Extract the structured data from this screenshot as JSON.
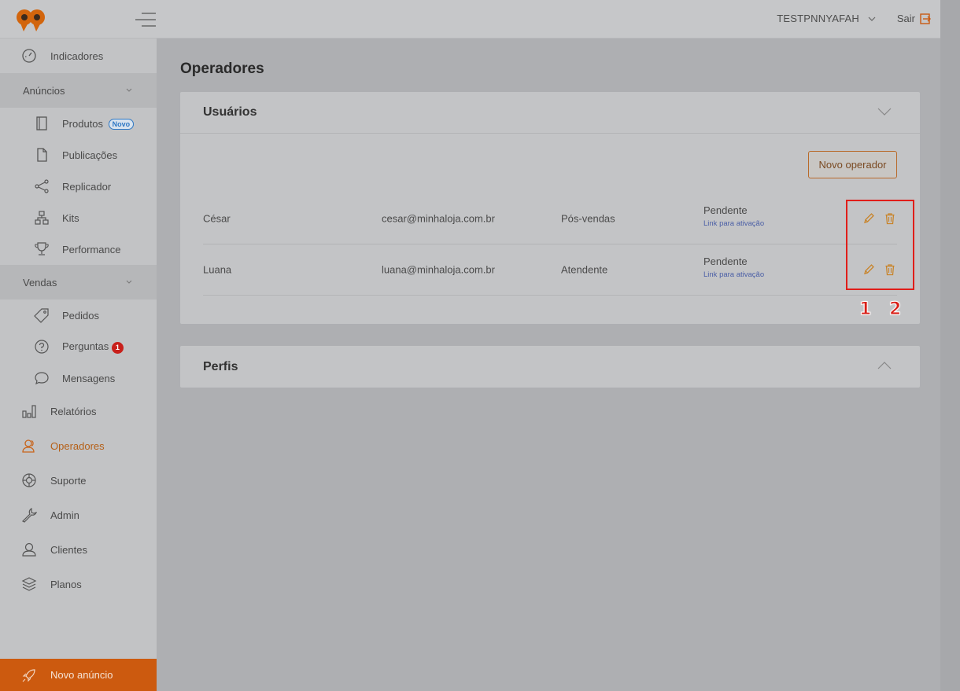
{
  "header": {
    "user_name": "TESTPNNYAFAH",
    "logout_label": "Sair"
  },
  "sidebar": {
    "indicadores": "Indicadores",
    "anuncios": "Anúncios",
    "produtos": "Produtos",
    "produtos_badge": "Novo",
    "publicacoes": "Publicações",
    "replicador": "Replicador",
    "kits": "Kits",
    "performance": "Performance",
    "vendas": "Vendas",
    "pedidos": "Pedidos",
    "perguntas": "Perguntas",
    "perguntas_count": "1",
    "mensagens": "Mensagens",
    "relatorios": "Relatórios",
    "operadores": "Operadores",
    "suporte": "Suporte",
    "admin": "Admin",
    "clientes": "Clientes",
    "planos": "Planos",
    "novo_anuncio": "Novo anúncio"
  },
  "main": {
    "page_title": "Operadores",
    "users_card": {
      "title": "Usuários",
      "new_button": "Novo operador",
      "rows": [
        {
          "name": "César",
          "email": "cesar@minhaloja.com.br",
          "role": "Pós-vendas",
          "status": "Pendente",
          "link": "Link para ativação"
        },
        {
          "name": "Luana",
          "email": "luana@minhaloja.com.br",
          "role": "Atendente",
          "status": "Pendente",
          "link": "Link para ativação"
        }
      ]
    },
    "profiles_card": {
      "title": "Perfis"
    }
  },
  "annotations": {
    "label_1": "1",
    "label_2": "2"
  },
  "colors": {
    "accent": "#cc5a0f",
    "highlight": "#e01e1a",
    "link": "#4b5fa6"
  }
}
